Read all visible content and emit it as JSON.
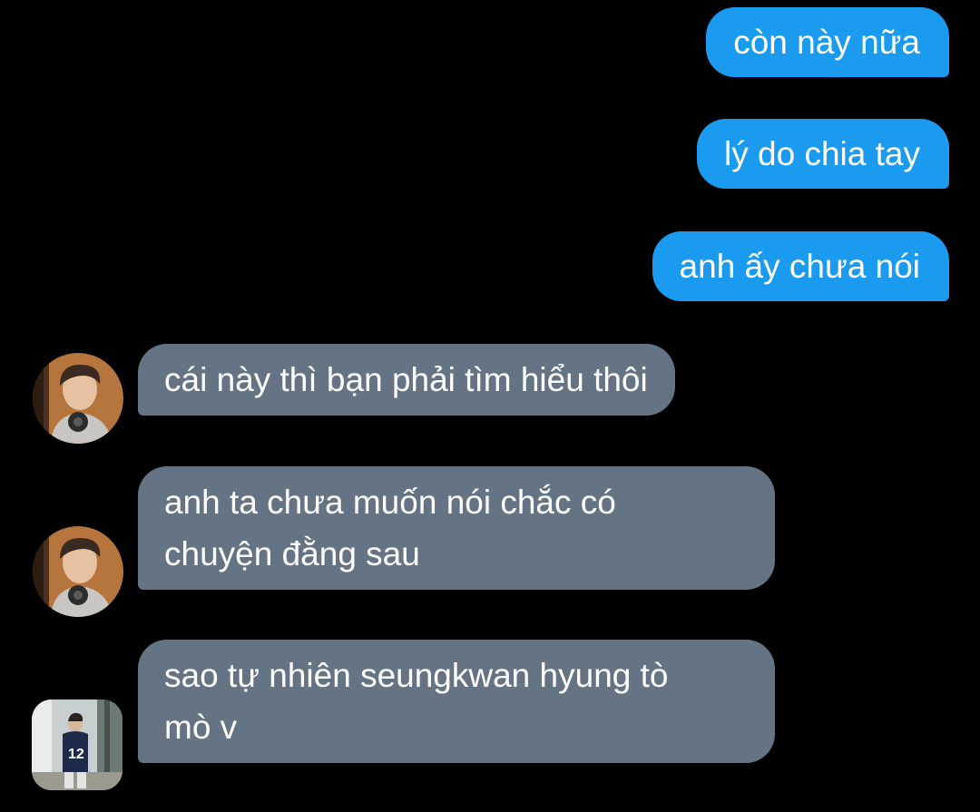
{
  "messages": [
    {
      "side": "sent",
      "text": "còn này nữa"
    },
    {
      "side": "sent",
      "text": "lý do chia tay"
    },
    {
      "side": "sent",
      "text": "anh ấy chưa nói"
    },
    {
      "side": "received",
      "text": "cái này thì bạn phải tìm hiểu thôi",
      "avatar": "person-with-headphones"
    },
    {
      "side": "received",
      "text": "anh ta chưa muốn nói chắc có\nchuyện đằng sau",
      "avatar": "person-with-headphones"
    },
    {
      "side": "received",
      "text": "sao tự nhiên seungkwan hyung tò\nmò v",
      "avatar": "person-in-jersey"
    }
  ],
  "colors": {
    "background": "#000000",
    "sent_bubble": "#1a9bf0",
    "received_bubble": "#647485",
    "text": "#ffffff"
  }
}
